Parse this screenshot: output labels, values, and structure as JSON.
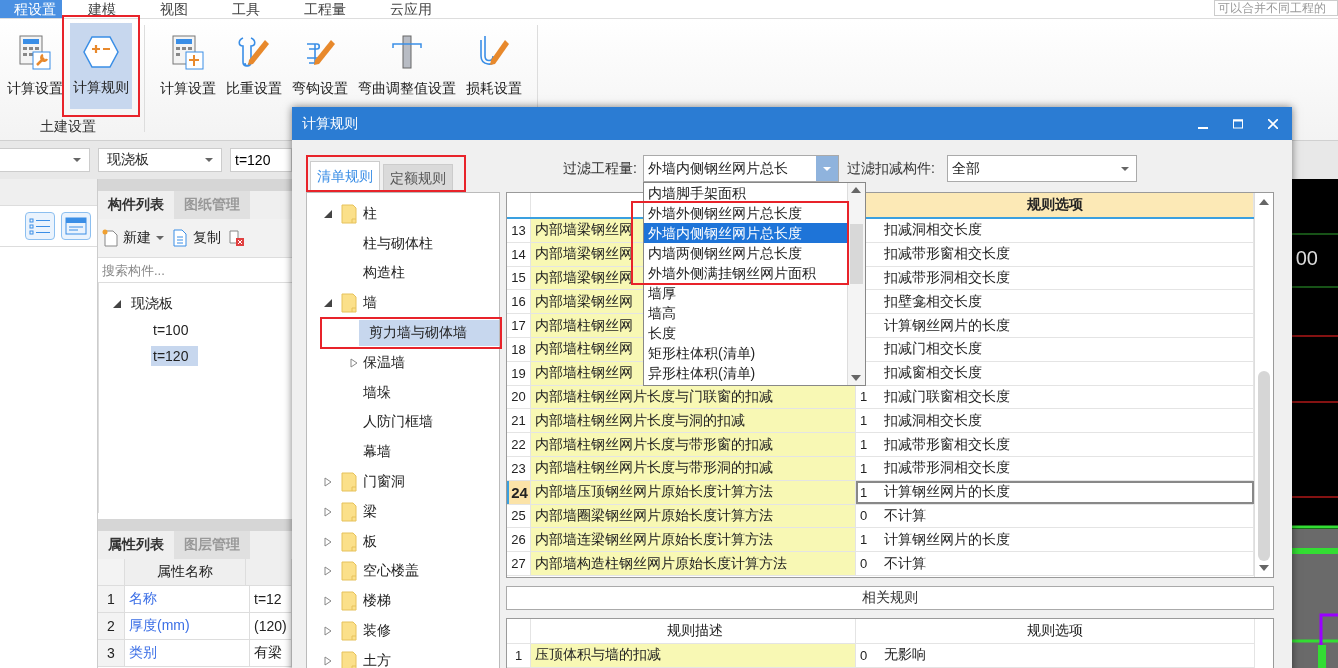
{
  "menu_tabs": [
    {
      "label": "程设置",
      "selected": true
    },
    {
      "label": "建模",
      "selected": false
    },
    {
      "label": "视图",
      "selected": false
    },
    {
      "label": "工具",
      "selected": false
    },
    {
      "label": "工程量",
      "selected": false
    },
    {
      "label": "云应用",
      "selected": false
    }
  ],
  "search": {
    "placeholder": "可以合并不同工程的"
  },
  "ribbon": {
    "groups": [
      {
        "label": "土建设置",
        "buttons": [
          {
            "label": "计算设置",
            "selected": false,
            "annotated": false
          },
          {
            "label": "计算规则",
            "selected": true,
            "annotated": true
          }
        ]
      },
      {
        "buttons": [
          {
            "label": "计算设置",
            "selected": false,
            "annotated": false
          },
          {
            "label": "比重设置",
            "selected": false,
            "annotated": false
          },
          {
            "label": "弯钩设置",
            "selected": false,
            "annotated": false
          },
          {
            "label": "弯曲调整值设置",
            "selected": false,
            "annotated": false
          },
          {
            "label": "损耗设置",
            "selected": false,
            "annotated": false
          }
        ]
      }
    ]
  },
  "selectors": [
    {
      "kind": "combo",
      "value": "现浇板"
    },
    {
      "kind": "field",
      "value": "t=120"
    }
  ],
  "component_panel": {
    "tabs": [
      {
        "label": "构件列表",
        "selected": true
      },
      {
        "label": "图纸管理",
        "selected": false
      }
    ],
    "toolbar": [
      {
        "label": "新建",
        "menu": true
      },
      {
        "label": "复制",
        "menu": false
      },
      {
        "menu": false
      }
    ],
    "search": {
      "placeholder": "搜索构件..."
    },
    "tree": [
      {
        "label": "现浇板",
        "expanded": true,
        "selected": false,
        "children": [
          {
            "label": "t=100",
            "selected": false
          },
          {
            "label": "t=120",
            "selected": true
          }
        ]
      }
    ]
  },
  "property_panel": {
    "tabs": [
      {
        "label": "属性列表",
        "selected": true
      },
      {
        "label": "图层管理",
        "selected": false
      }
    ],
    "columns": [
      "属性名称"
    ],
    "rows": [
      {
        "index": "1",
        "name": "名称",
        "value": "t=12"
      },
      {
        "index": "2",
        "name": "厚度(mm)",
        "value": "(120)"
      },
      {
        "index": "3",
        "name": "类别",
        "value": "有梁"
      }
    ]
  },
  "canvas": {
    "label": "00"
  },
  "dialog": {
    "title": "计算规则",
    "tabs_annotated": true,
    "tabs": [
      {
        "label": "清单规则",
        "selected": true
      },
      {
        "label": "定额规则",
        "selected": false
      }
    ],
    "tree": [
      {
        "label": "柱",
        "kind": "folder",
        "expanded": true,
        "selected": false,
        "annotated": false,
        "children": [
          {
            "label": "柱与砌体柱",
            "kind": "leaf",
            "selected": false,
            "annotated": false
          },
          {
            "label": "构造柱",
            "kind": "leaf",
            "selected": false,
            "annotated": false
          }
        ]
      },
      {
        "label": "墙",
        "kind": "folder",
        "expanded": true,
        "selected": false,
        "annotated": false,
        "children": [
          {
            "label": "剪力墙与砌体墙",
            "kind": "leaf",
            "selected": true,
            "annotated": true
          },
          {
            "label": "保温墙",
            "kind": "group",
            "expanded": false,
            "selected": false,
            "annotated": false
          },
          {
            "label": "墙垛",
            "kind": "leaf",
            "selected": false,
            "annotated": false
          },
          {
            "label": "人防门框墙",
            "kind": "leaf",
            "selected": false,
            "annotated": false
          },
          {
            "label": "幕墙",
            "kind": "leaf",
            "selected": false,
            "annotated": false
          }
        ]
      },
      {
        "label": "门窗洞",
        "kind": "folder",
        "expanded": false,
        "selected": false,
        "annotated": false
      },
      {
        "label": "梁",
        "kind": "folder",
        "expanded": false,
        "selected": false,
        "annotated": false
      },
      {
        "label": "板",
        "kind": "folder",
        "expanded": false,
        "selected": false,
        "annotated": false
      },
      {
        "label": "空心楼盖",
        "kind": "folder",
        "expanded": false,
        "selected": false,
        "annotated": false
      },
      {
        "label": "楼梯",
        "kind": "folder",
        "expanded": false,
        "selected": false,
        "annotated": false
      },
      {
        "label": "装修",
        "kind": "folder",
        "expanded": false,
        "selected": false,
        "annotated": false
      },
      {
        "label": "土方",
        "kind": "folder",
        "expanded": false,
        "selected": false,
        "annotated": false
      }
    ],
    "filters": [
      {
        "label": "过滤工程量:",
        "value": "外墙内侧钢丝网片总长",
        "open": true,
        "options": [
          {
            "label": "内墙脚手架面积",
            "selected": false,
            "annotated": false
          },
          {
            "label": "外墙外侧钢丝网片总长度",
            "selected": false,
            "annotated": true
          },
          {
            "label": "外墙内侧钢丝网片总长度",
            "selected": true,
            "annotated": true
          },
          {
            "label": "内墙两侧钢丝网片总长度",
            "selected": false,
            "annotated": true
          },
          {
            "label": "外墙外侧满挂钢丝网片面积",
            "selected": false,
            "annotated": true
          },
          {
            "label": "墙厚",
            "selected": false,
            "annotated": false
          },
          {
            "label": "墙高",
            "selected": false,
            "annotated": false
          },
          {
            "label": "长度",
            "selected": false,
            "annotated": false
          },
          {
            "label": "矩形柱体积(清单)",
            "selected": false,
            "annotated": false
          },
          {
            "label": "异形柱体积(清单)",
            "selected": false,
            "annotated": false
          }
        ]
      },
      {
        "label": "过滤扣减构件:",
        "value": "全部",
        "open": false
      }
    ],
    "rules": {
      "option_header": "规则选项",
      "rows": [
        {
          "index": "13",
          "description": "内部墙梁钢丝网",
          "option": "扣减洞相交长度",
          "selected": false
        },
        {
          "index": "14",
          "description": "内部墙梁钢丝网",
          "option": "扣减带形窗相交长度",
          "selected": false
        },
        {
          "index": "15",
          "description": "内部墙梁钢丝网",
          "option": "扣减带形洞相交长度",
          "selected": false
        },
        {
          "index": "16",
          "description": "内部墙梁钢丝网",
          "option": "扣壁龛相交长度",
          "selected": false
        },
        {
          "index": "17",
          "description": "内部墙柱钢丝网",
          "option": "计算钢丝网片的长度",
          "selected": false
        },
        {
          "index": "18",
          "description": "内部墙柱钢丝网",
          "option": "扣减门相交长度",
          "selected": false
        },
        {
          "index": "19",
          "description": "内部墙柱钢丝网",
          "option": "扣减窗相交长度",
          "selected": false
        },
        {
          "index": "20",
          "description": "内部墙柱钢丝网片长度与门联窗的扣减",
          "value": "1",
          "option": "扣减门联窗相交长度",
          "selected": false
        },
        {
          "index": "21",
          "description": "内部墙柱钢丝网片长度与洞的扣减",
          "value": "1",
          "option": "扣减洞相交长度",
          "selected": false
        },
        {
          "index": "22",
          "description": "内部墙柱钢丝网片长度与带形窗的扣减",
          "value": "1",
          "option": "扣减带形窗相交长度",
          "selected": false
        },
        {
          "index": "23",
          "description": "内部墙柱钢丝网片长度与带形洞的扣减",
          "value": "1",
          "option": "扣减带形洞相交长度",
          "selected": false
        },
        {
          "index": "24",
          "description": "内部墙压顶钢丝网片原始长度计算方法",
          "value": "1",
          "option": "计算钢丝网片的长度",
          "selected": true
        },
        {
          "index": "25",
          "description": "内部墙圈梁钢丝网片原始长度计算方法",
          "value": "0",
          "option": "不计算",
          "selected": false
        },
        {
          "index": "26",
          "description": "内部墙连梁钢丝网片原始长度计算方法",
          "value": "1",
          "option": "计算钢丝网片的长度",
          "selected": false
        },
        {
          "index": "27",
          "description": "内部墙构造柱钢丝网片原始长度计算方法",
          "value": "0",
          "option": "不计算",
          "selected": false
        }
      ]
    },
    "related_button": "相关规则",
    "related": {
      "columns": [
        "规则描述",
        "规则选项"
      ],
      "rows": [
        {
          "index": "1",
          "description": "压顶体积与墙的扣减",
          "value": "0",
          "option": "无影响"
        }
      ]
    }
  }
}
